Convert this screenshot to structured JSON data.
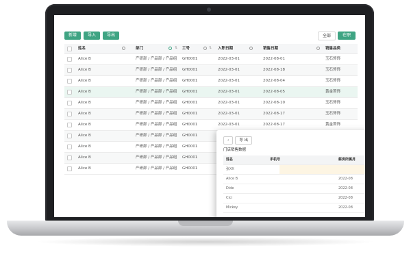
{
  "toolbar": {
    "add": "新增",
    "import": "导入",
    "export": "导出",
    "all": "全部",
    "on_job": "在职"
  },
  "table": {
    "headers": [
      "姓名",
      "部门",
      "工号",
      "入职日期",
      "销售日期",
      "销售品类"
    ],
    "rows": [
      [
        "Alice B",
        "产研部 / 产品部 / 产品组",
        "GH0001",
        "2022-03-01",
        "2022-08-01",
        "玉石饰饰"
      ],
      [
        "Alice B",
        "产研部 / 产品部 / 产品组",
        "GH0001",
        "2022-03-01",
        "2022-08-18",
        "玉石饰饰"
      ],
      [
        "Alice B",
        "产研部 / 产品部 / 产品组",
        "GH0001",
        "2022-03-01",
        "2022-08-04",
        "玉石饰饰"
      ],
      [
        "Alice B",
        "产研部 / 产品部 / 产品组",
        "GH0001",
        "2022-03-01",
        "2022-08-05",
        "黄金首饰"
      ],
      [
        "Alice B",
        "产研部 / 产品部 / 产品组",
        "GH0001",
        "2022-03-01",
        "2022-08-10",
        "玉石饰饰"
      ],
      [
        "Alice B",
        "产研部 / 产品部 / 产品组",
        "GH0001",
        "2022-03-01",
        "2022-08-17",
        "玉石饰饰"
      ],
      [
        "Alice B",
        "产研部 / 产品部 / 产品组",
        "GH0001",
        "2022-03-01",
        "2022-08-17",
        "黄金首饰"
      ],
      [
        "Alice B",
        "产研部 / 产品部 / 产品组",
        "GH0001",
        "",
        "",
        ""
      ],
      [
        "Alice B",
        "产研部 / 产品部 / 产品组",
        "GH0001",
        "",
        "",
        ""
      ],
      [
        "Alice B",
        "产研部 / 产品部 / 产品组",
        "GH0001",
        "",
        "",
        ""
      ],
      [
        "Alice B",
        "产研部 / 产品部 / 产品组",
        "GH0001",
        "",
        "",
        ""
      ]
    ]
  },
  "popup": {
    "export": "导 出",
    "title": "门店销售数据",
    "headers": [
      "姓名",
      "手机号",
      "薪资所属月"
    ],
    "rows": [
      [
        "张XX",
        "",
        ""
      ],
      [
        "Alice B",
        "",
        "2022-08"
      ],
      [
        "Dide",
        "",
        "2022-08"
      ],
      [
        "Cici",
        "",
        "2022-08"
      ],
      [
        "Mickey",
        "",
        "2022-08"
      ]
    ]
  },
  "colors": {
    "accent": "#3fa483",
    "highlight_row": "#eaf6f1",
    "laptop_bezel": "#1e1f22"
  }
}
